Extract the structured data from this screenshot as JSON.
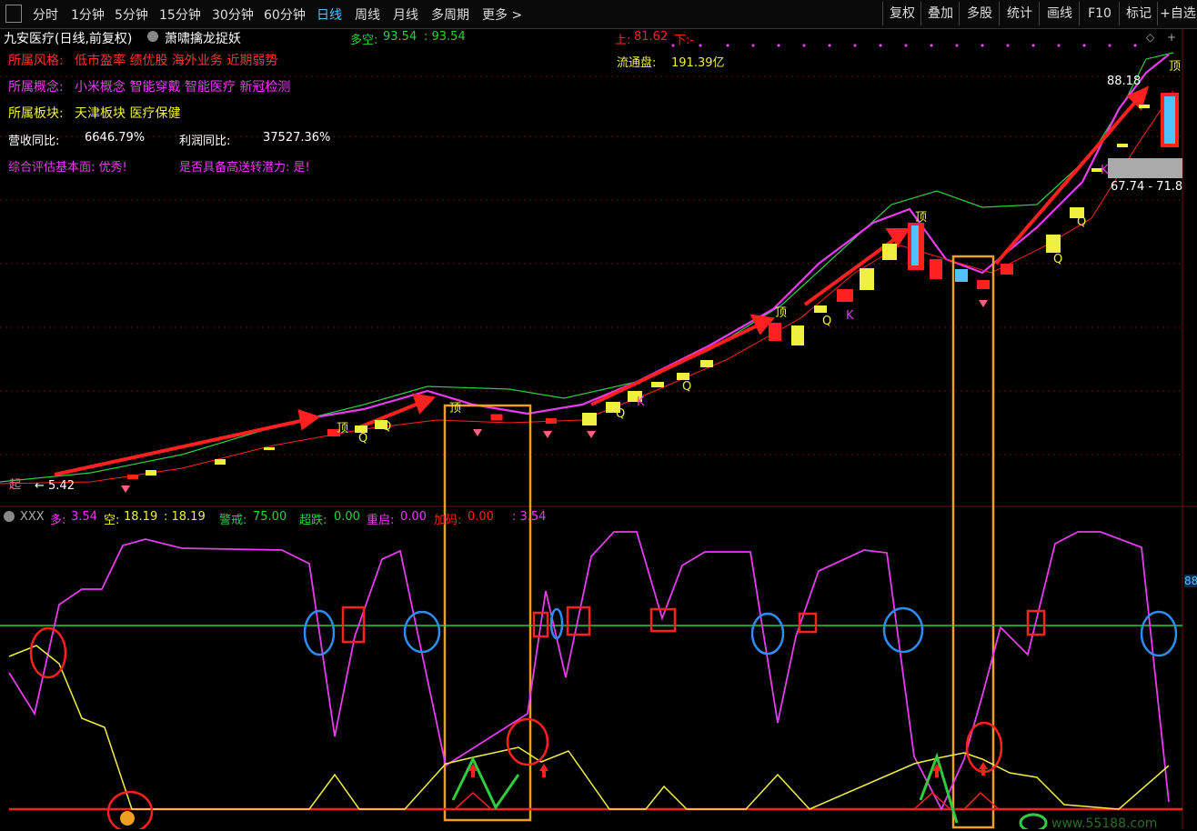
{
  "toolbar": {
    "periods": [
      "分时",
      "1分钟",
      "5分钟",
      "15分钟",
      "30分钟",
      "60分钟",
      "日线",
      "周线",
      "月线",
      "多周期",
      "更多 >"
    ],
    "active_period": "日线",
    "right_buttons": [
      "复权",
      "叠加",
      "多股",
      "统计",
      "画线",
      "F10",
      "标记",
      "+自选"
    ]
  },
  "header": {
    "stock_title": "九安医疗(日线,前复权)",
    "indicator_name": "萧啸擒龙捉妖",
    "duokong_label": "多空:",
    "duokong_value": "93.54",
    "duokong_value2": ": 93.54",
    "up_label": "上:",
    "up_value": "81.62",
    "down_label": "下:-",
    "float_label": "流通盘:",
    "float_value": "191.39亿"
  },
  "info": {
    "style_label": "所属风格:",
    "style_value": "低市盈率 绩优股 海外业务 近期弱势",
    "concept_label": "所属概念:",
    "concept_value": "小米概念 智能穿戴 智能医疗 新冠检测",
    "sector_label": "所属板块:",
    "sector_value": "天津板块 医疗保健",
    "revenue_label": "营收同比:",
    "revenue_value": "6646.79%",
    "profit_label": "利润同比:",
    "profit_value": "37527.36%",
    "eval_text": "综合评估基本面: 优秀!",
    "potential_text": "是否具备高送转潜力: 是!"
  },
  "main_chart": {
    "price_high_label": "88.18",
    "price_range_label": "67.74 - 71.8",
    "low_price_label": "5.42",
    "markers": {
      "top": "顶",
      "q": "Q",
      "k": "K",
      "qi": "起"
    }
  },
  "sub_chart": {
    "name": "XXX",
    "duo_label": "多:",
    "duo_value": "3.54",
    "kong_label": "空:",
    "kong_value": "18.19",
    "kong_value2": ": 18.19",
    "warn_label": "警戒:",
    "warn_value": "75.00",
    "oversold_label": "超跌:",
    "oversold_value": "0.00",
    "restart_label": "重启:",
    "restart_value": "0.00",
    "addcode_label": "加码:",
    "addcode_value": "0.00",
    "last_value": ": 3.54",
    "right_axis_value": "88"
  },
  "watermark": "www.55188.com",
  "colors": {
    "magenta": "#e83cf0",
    "yellow": "#f0f040",
    "green": "#2ecc40",
    "red": "#ff2020",
    "orange": "#f0a020",
    "blue": "#2f8cf0",
    "cyan": "#4fc3ff"
  }
}
